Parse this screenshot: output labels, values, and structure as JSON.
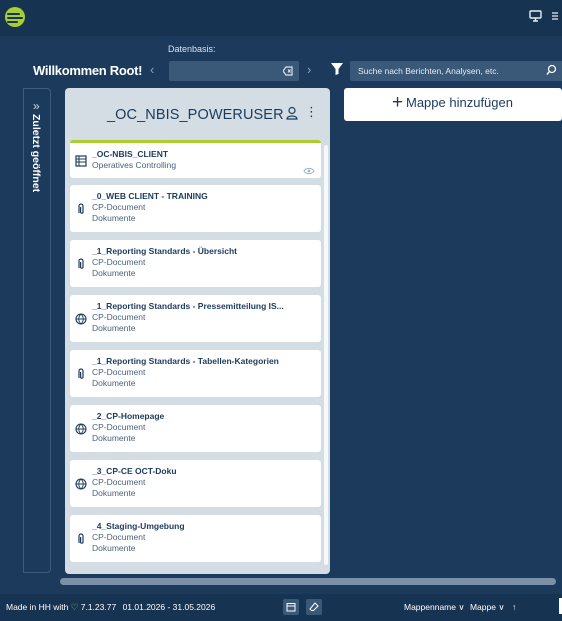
{
  "header": {
    "logo_icon": "leaf-logo-icon",
    "right_icons": [
      "monitor-icon",
      "menu-icon"
    ]
  },
  "context": {
    "datenbasis_label": "Datenbasis:",
    "welcome": "Willkommen Root!",
    "search_placeholder": "Suche nach Berichten, Analysen, etc."
  },
  "sidebar": {
    "label": "Zuletzt geöffnet",
    "expand_glyph": "»"
  },
  "panel": {
    "title": "_OC_NBIS_POWERUSER",
    "cards": [
      {
        "title": "_OC-NBIS_CLIENT",
        "sub": "Operatives Controlling",
        "sub2": "",
        "icon": "table-icon",
        "active": true
      },
      {
        "title": "_0_WEB CLIENT - TRAINING",
        "sub": "CP-Document",
        "sub2": "Dokumente",
        "icon": "paperclip-icon"
      },
      {
        "title": "_1_Reporting Standards - Übersicht",
        "sub": "CP-Document",
        "sub2": "Dokumente",
        "icon": "paperclip-icon"
      },
      {
        "title": "_1_Reporting Standards - Pressemitteilung IS...",
        "sub": "CP-Document",
        "sub2": "Dokumente",
        "icon": "globe-icon"
      },
      {
        "title": "_1_Reporting Standards - Tabellen-Kategorien",
        "sub": "CP-Document",
        "sub2": "Dokumente",
        "icon": "paperclip-icon"
      },
      {
        "title": "_2_CP-Homepage",
        "sub": "CP-Document",
        "sub2": "Dokumente",
        "icon": "globe-icon"
      },
      {
        "title": "_3_CP-CE OCT-Doku",
        "sub": "CP-Document",
        "sub2": "Dokumente",
        "icon": "globe-icon"
      },
      {
        "title": "_4_Staging-Umgebung",
        "sub": "CP-Document",
        "sub2": "Dokumente",
        "icon": "paperclip-icon"
      }
    ]
  },
  "add_folder": {
    "plus": "+",
    "label": "Mappe hinzufügen"
  },
  "footer": {
    "made_in": "Made in HH with",
    "heart": "♡",
    "version": "7.1.23.77",
    "date_range": "01.01.2026 - 31.05.2026",
    "sort_name": "Mappenname",
    "sort_type": "Mappe",
    "chevron": "∨",
    "up_arrow": "↑"
  },
  "colors": {
    "background": "#1c3b5c",
    "accent": "#a8cf2f",
    "card": "#ffffff",
    "panel": "#d4dce4"
  }
}
